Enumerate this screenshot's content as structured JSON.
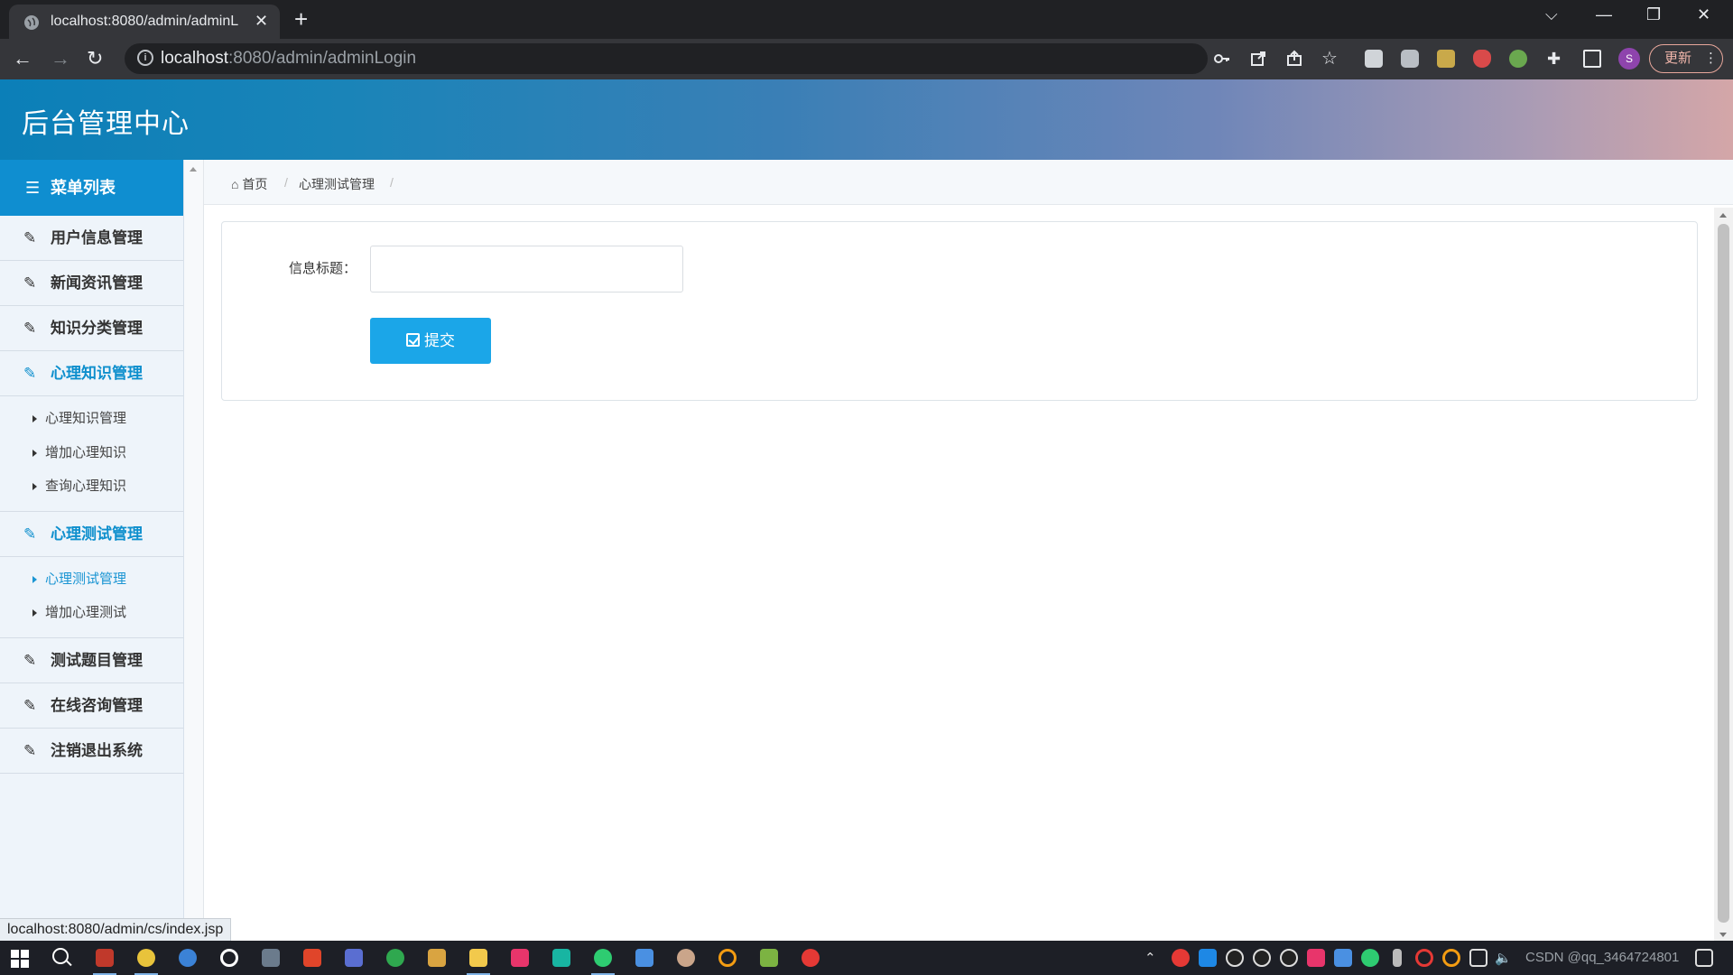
{
  "browser": {
    "tab_title": "localhost:8080/admin/adminL",
    "tab_close": "✕",
    "new_tab": "+",
    "url_host": "localhost",
    "url_path": ":8080/admin/adminLogin",
    "update_label": "更新",
    "profile_initial": "S",
    "status_url": "localhost:8080/admin/cs/index.jsp"
  },
  "app": {
    "title": "后台管理中心"
  },
  "sidebar": {
    "header": "菜单列表",
    "items": [
      {
        "label": "用户信息管理"
      },
      {
        "label": "新闻资讯管理"
      },
      {
        "label": "知识分类管理"
      },
      {
        "label": "心理知识管理",
        "sub": [
          "心理知识管理",
          "增加心理知识",
          "查询心理知识"
        ]
      },
      {
        "label": "心理测试管理",
        "sub": [
          "心理测试管理",
          "增加心理测试"
        ]
      },
      {
        "label": "测试题目管理"
      },
      {
        "label": "在线咨询管理"
      },
      {
        "label": "注销退出系统"
      }
    ]
  },
  "breadcrumb": {
    "home": "首页",
    "current": "心理测试管理",
    "sep": "/"
  },
  "form": {
    "label": "信息标题：",
    "value": "",
    "submit_label": "提交"
  },
  "taskbar": {
    "tray_text": "CSDN @qq_3464724801"
  },
  "colors": {
    "accent": "#0f8ed0",
    "button": "#1ba6e8",
    "active_text": "#0e8fcd"
  }
}
